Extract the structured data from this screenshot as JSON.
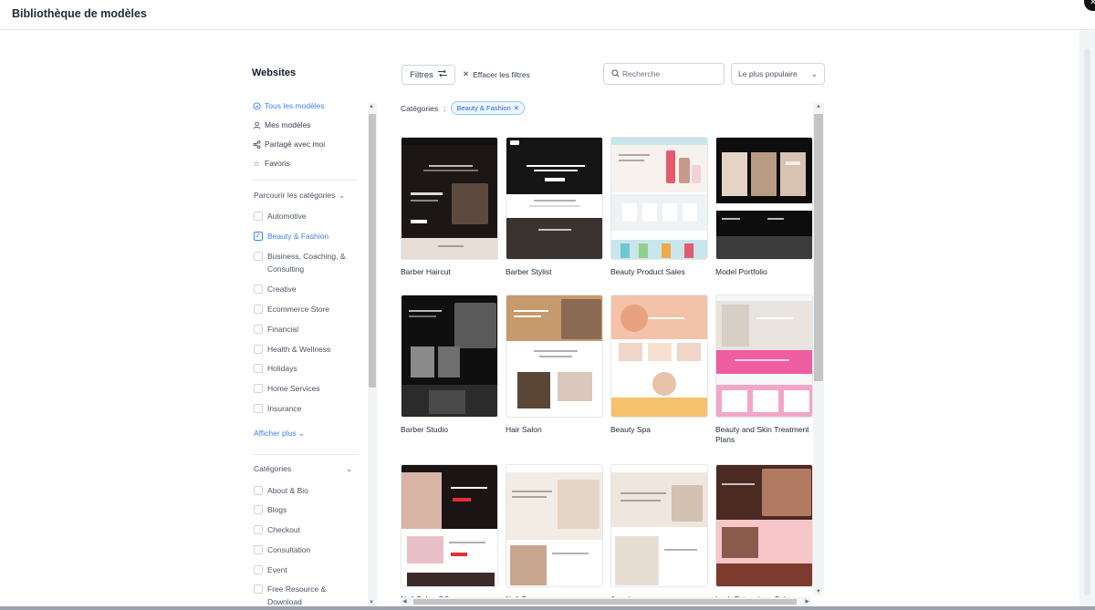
{
  "header": {
    "title": "Bibliothèque de modèles"
  },
  "sidebar": {
    "title": "Websites",
    "nav": [
      {
        "label": "Tous les modèles",
        "icon": "check-circle-icon",
        "active": true
      },
      {
        "label": "Mes modèles",
        "icon": "user-icon",
        "active": false
      },
      {
        "label": "Partagé avec moi",
        "icon": "share-icon",
        "active": false
      },
      {
        "label": "Favoris",
        "icon": "star-icon",
        "active": false
      }
    ],
    "browse_heading": "Parcourir les catégories",
    "browse_items": [
      {
        "label": "Automotive",
        "checked": false
      },
      {
        "label": "Beauty & Fashion",
        "checked": true
      },
      {
        "label": "Business, Coaching, &",
        "label2": "Consulting",
        "checked": false
      },
      {
        "label": "Creative",
        "checked": false
      },
      {
        "label": "Ecommerce Store",
        "checked": false
      },
      {
        "label": "Financial",
        "checked": false
      },
      {
        "label": "Health & Wellness",
        "checked": false
      },
      {
        "label": "Holidays",
        "checked": false
      },
      {
        "label": "Home Services",
        "checked": false
      },
      {
        "label": "Insurance",
        "checked": false
      }
    ],
    "show_more": "Afficher plus",
    "categories_heading": "Catégories",
    "category_items": [
      {
        "label": "About & Bio",
        "checked": false
      },
      {
        "label": "Blogs",
        "checked": false
      },
      {
        "label": "Checkout",
        "checked": false
      },
      {
        "label": "Consultation",
        "checked": false
      },
      {
        "label": "Event",
        "checked": false
      },
      {
        "label": "Free Resource &",
        "label2": "Download",
        "checked": false
      }
    ]
  },
  "toolbar": {
    "filters_label": "Filtres",
    "clear_label": "Effacer les filtres",
    "search_placeholder": "Recherche",
    "sort_value": "Le plus populaire"
  },
  "active_filters": {
    "label": "Catégories",
    "separator": ":",
    "tag": "Beauty & Fashion"
  },
  "templates": [
    {
      "name": "Barber Haircut",
      "palette": [
        "#1c1714",
        "#e9ded5",
        "#9c7a5e"
      ]
    },
    {
      "name": "Barber Stylist",
      "palette": [
        "#151515",
        "#ffffff",
        "#3a3330"
      ]
    },
    {
      "name": "Beauty Product Sales",
      "palette": [
        "#f7f2ee",
        "#c8e6ec",
        "#e45a6f"
      ]
    },
    {
      "name": "Model Portfolio",
      "palette": [
        "#0d0d0d",
        "#3b3b3b",
        "#e5d3c4"
      ]
    },
    {
      "name": "Barber Studio",
      "palette": [
        "#0f0f0f",
        "#2b2b2b",
        "#8a8a8a"
      ]
    },
    {
      "name": "Hair Salon",
      "palette": [
        "#c69a6c",
        "#ffffff",
        "#5b4636"
      ]
    },
    {
      "name": "Beauty Spa",
      "palette": [
        "#f4c2a8",
        "#ffffff",
        "#f5c16c"
      ]
    },
    {
      "name": "Beauty and Skin Treatment Plans",
      "palette": [
        "#e9e4df",
        "#ee5ea1",
        "#f7f7f7"
      ]
    },
    {
      "name": "Nail Salon Offer",
      "palette": [
        "#1a1414",
        "#d8b3a6",
        "#ffffff"
      ]
    },
    {
      "name": "Nail Care",
      "palette": [
        "#f2ece4",
        "#ffffff",
        "#c9a690"
      ]
    },
    {
      "name": "Jewelry",
      "palette": [
        "#efe6dd",
        "#ffffff",
        "#d3c2b2"
      ]
    },
    {
      "name": "Lash Extensions Salon",
      "palette": [
        "#4b2a22",
        "#f7c6c9",
        "#7d3a2f"
      ]
    }
  ]
}
